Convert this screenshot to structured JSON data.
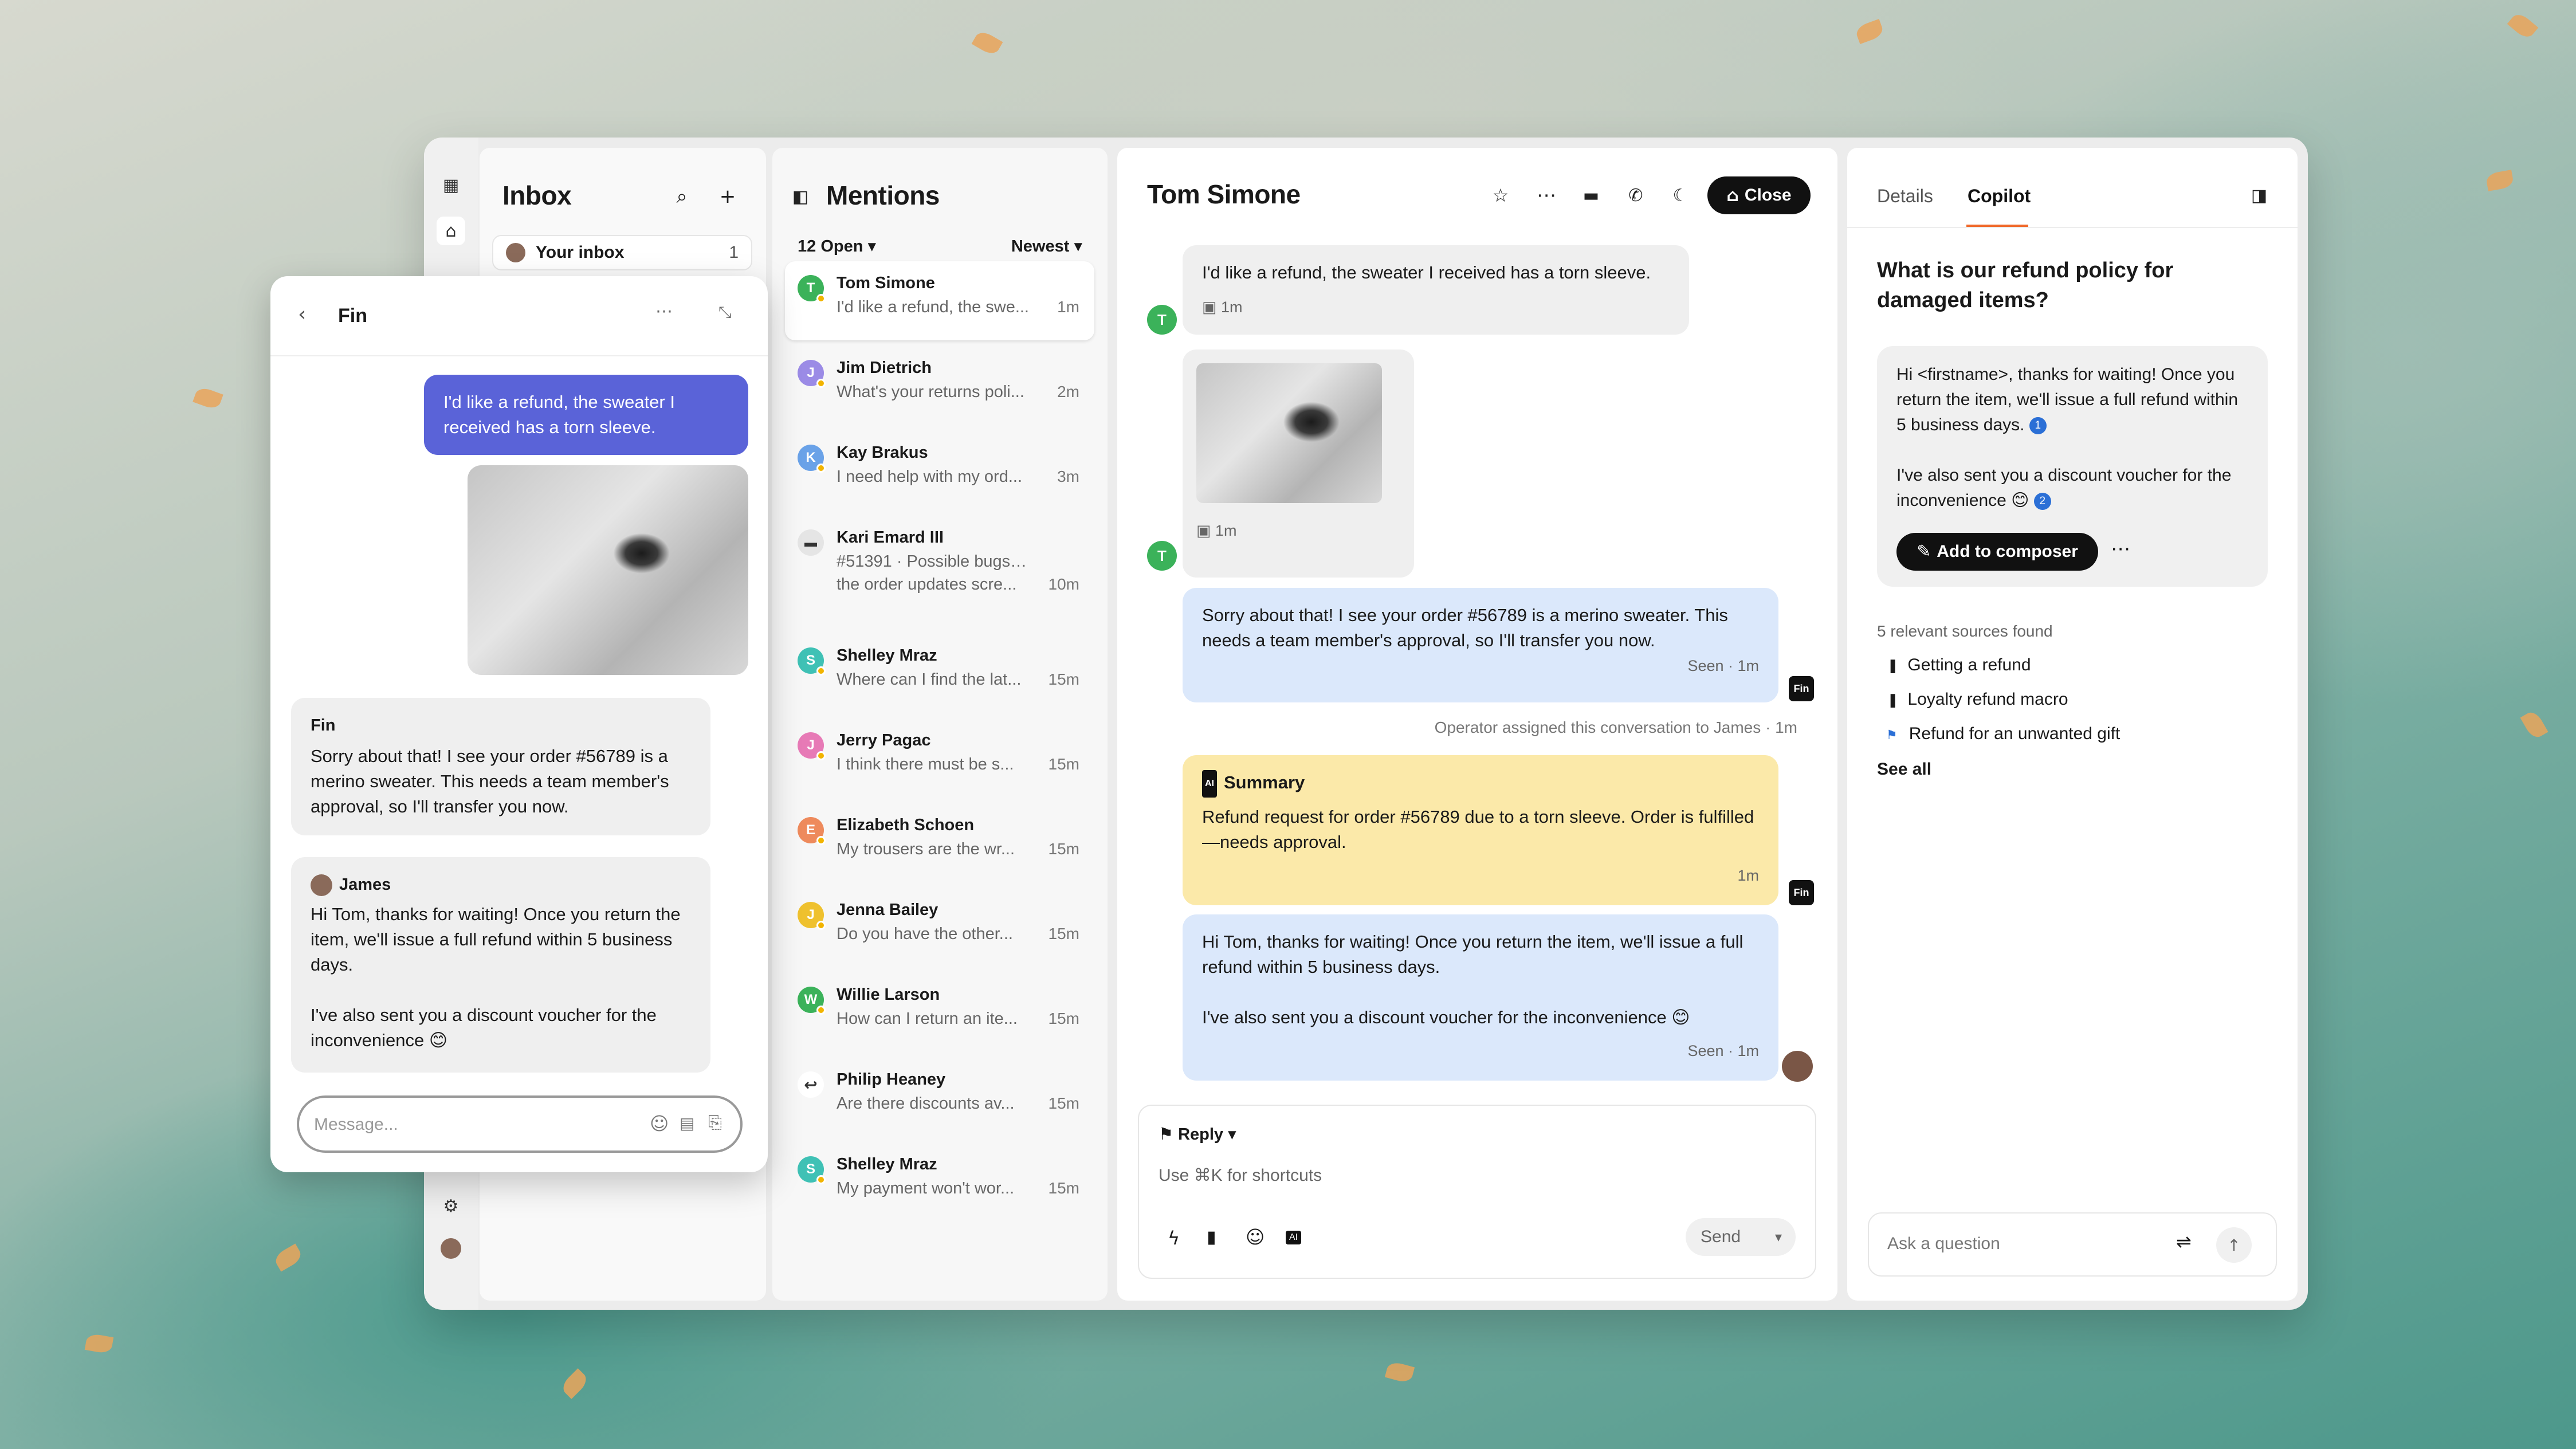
{
  "inbox": {
    "title": "Inbox",
    "chip_label": "Your inbox",
    "chip_count": "1"
  },
  "mentions": {
    "title": "Mentions",
    "filter": "12 Open",
    "sort": "Newest",
    "items": [
      {
        "name": "Tom Simone",
        "initial": "T",
        "color": "#3bb25a",
        "snippet": "I'd like a refund, the swe...",
        "time": "1m"
      },
      {
        "name": "Jim Dietrich",
        "initial": "J",
        "color": "#9b8be6",
        "snippet": "What's your returns poli...",
        "time": "2m"
      },
      {
        "name": "Kay Brakus",
        "initial": "K",
        "color": "#6aa2e8",
        "snippet": "I need help with my ord...",
        "time": "3m"
      },
      {
        "name": "Kari Emard III",
        "initial": "",
        "color": "#e5e5e5",
        "snippet": "#51391 · Possible bugs with...",
        "snippet2": "the order updates scre...",
        "time": "10m"
      },
      {
        "name": "Shelley Mraz",
        "initial": "S",
        "color": "#3fc1b5",
        "snippet": "Where can I find the lat...",
        "time": "15m"
      },
      {
        "name": "Jerry Pagac",
        "initial": "J",
        "color": "#e77ab6",
        "snippet": "I think there must be s...",
        "time": "15m"
      },
      {
        "name": "Elizabeth Schoen",
        "initial": "E",
        "color": "#ee8a5c",
        "snippet": "My trousers are the wr...",
        "time": "15m"
      },
      {
        "name": "Jenna Bailey",
        "initial": "J",
        "color": "#efc12e",
        "snippet": "Do you have the other...",
        "time": "15m"
      },
      {
        "name": "Willie Larson",
        "initial": "W",
        "color": "#3bb25a",
        "snippet": "How can I return an ite...",
        "time": "15m"
      },
      {
        "name": "Philip Heaney",
        "initial": "",
        "color": "#ffffff",
        "snippet": "Are there discounts av...",
        "time": "15m"
      },
      {
        "name": "Shelley Mraz",
        "initial": "S",
        "color": "#3fc1b5",
        "snippet": "My payment won't wor...",
        "time": "15m"
      }
    ]
  },
  "conversation": {
    "title": "Tom Simone",
    "close_label": "Close",
    "msg1": "I'd like a refund, the sweater I received has a torn sleeve.",
    "msg1_time": "1m",
    "img_time": "1m",
    "avatar_initial": "T",
    "reply1": "Sorry about that! I see your order #56789 is a merino sweater. This needs a team member's approval, so I'll transfer you now.",
    "reply1_meta": "Seen · 1m",
    "fin_badge": "Fin",
    "system_note": "Operator assigned this conversation to James · 1m",
    "summary_title": "Summary",
    "summary_text": "Refund request for order #56789 due to a torn sleeve. Order is fulfilled—needs approval.",
    "summary_time": "1m",
    "reply2a": "Hi Tom, thanks for waiting! Once you return the item, we'll issue a full refund within 5 business days.",
    "reply2b": "I've also sent you a discount voucher for the inconvenience 😊",
    "reply2_meta": "Seen · 1m",
    "composer": {
      "mode": "Reply",
      "placeholder": "Use ⌘K for shortcuts",
      "send": "Send"
    }
  },
  "sidebar": {
    "tabs": [
      "Details",
      "Copilot"
    ],
    "question": "What is our refund policy for damaged items?",
    "answer_p1": "Hi <firstname>, thanks for waiting! Once you return the item, we'll issue a full refund within 5 business days.",
    "answer_p2": "I've also sent you a discount voucher for the inconvenience 😊",
    "cite1": "1",
    "cite2": "2",
    "add_label": "Add to composer",
    "sources_heading": "5 relevant sources found",
    "sources": [
      "Getting a refund",
      "Loyalty refund macro",
      "Refund for an unwanted gift"
    ],
    "see_all": "See all",
    "ask_placeholder": "Ask a question"
  },
  "fin": {
    "title": "Fin",
    "user_msg": "I'd like a refund, the sweater I received has a torn sleeve.",
    "bot_name": "Fin",
    "bot_msg": "Sorry about that! I see your order #56789 is a merino sweater. This needs a team member's approval, so I'll transfer you now.",
    "agent_name": "James",
    "agent_p1": "Hi Tom, thanks for waiting! Once you return the item, we'll issue a full refund within 5 business days.",
    "agent_p2": "I've also sent you a discount voucher for the inconvenience 😊",
    "input_placeholder": "Message..."
  }
}
